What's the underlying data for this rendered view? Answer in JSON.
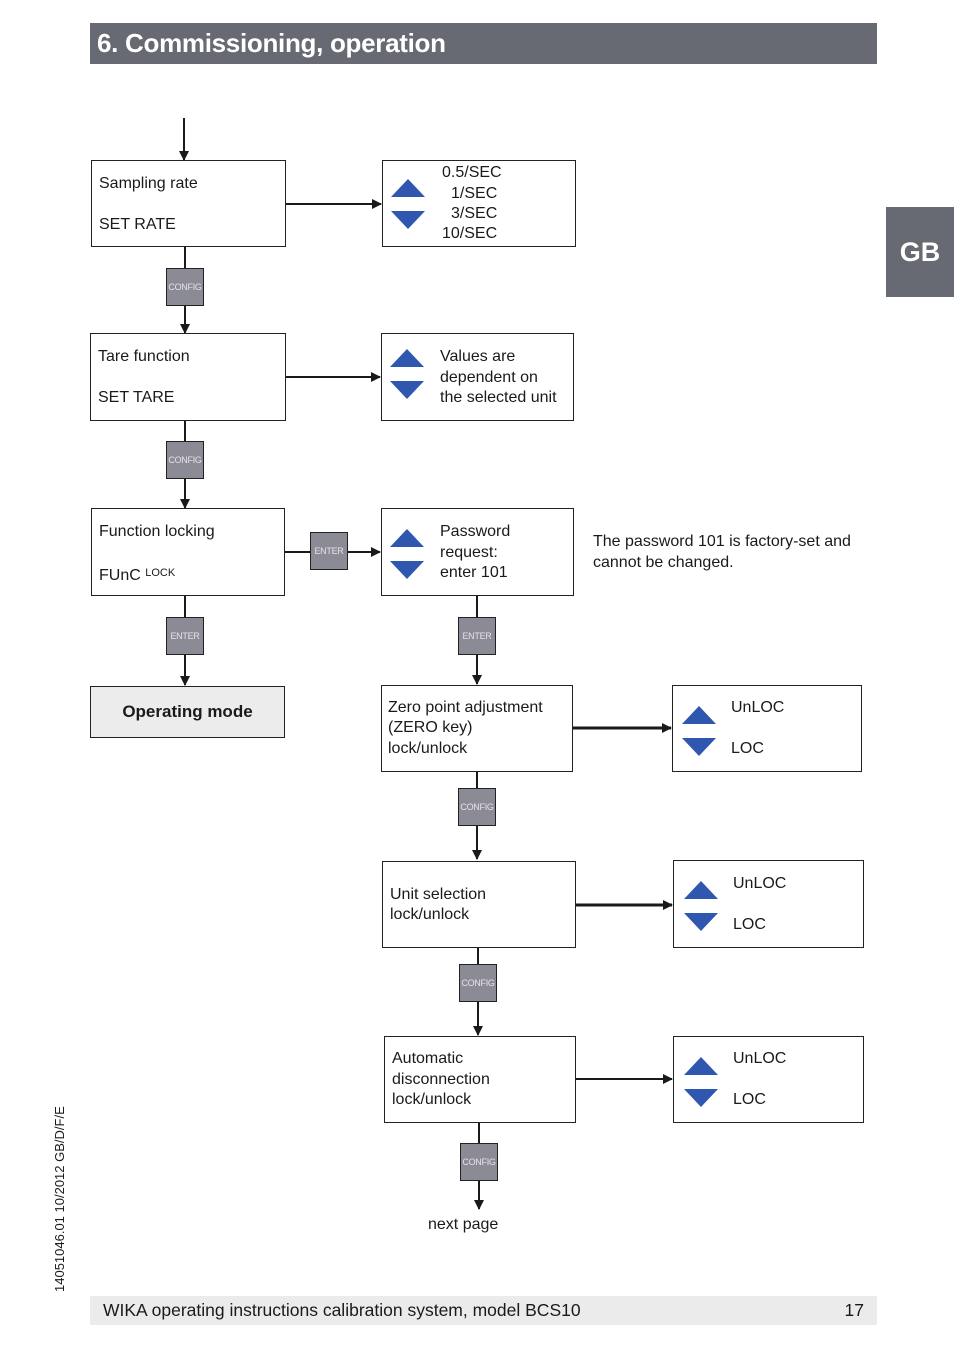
{
  "header": {
    "title": "6. Commissioning, operation"
  },
  "language_tab": "GB",
  "colors": {
    "header_bg": "#676a72",
    "arrow_blue": "#2f57b0",
    "key_bg": "#8a8b94",
    "operating_mode_bg": "#ececec",
    "footer_bg": "#ebebeb"
  },
  "keys": {
    "config": "CONFIG",
    "enter": "ENTER"
  },
  "nodes": {
    "sampling_rate": {
      "line1": "Sampling rate",
      "line2": "SET RATE"
    },
    "sampling_options": {
      "options": [
        "0.5/SEC",
        "1/SEC",
        "3/SEC",
        "10/SEC"
      ]
    },
    "tare": {
      "line1": "Tare function",
      "line2": "SET TARE"
    },
    "tare_values": {
      "lines": [
        "Values are",
        "dependent on",
        "the selected unit"
      ]
    },
    "func_lock": {
      "line1": "Function locking",
      "line2_main": "FUnC",
      "line2_sup": "LOCK"
    },
    "password": {
      "lines": [
        "Password",
        "request:",
        "enter 101"
      ]
    },
    "password_note": {
      "lines": [
        "The password 101 is factory-set and",
        "cannot be changed."
      ]
    },
    "operating_mode": {
      "label": "Operating mode"
    },
    "zero_point": {
      "lines": [
        "Zero point adjustment",
        "(ZERO key)",
        "lock/unlock"
      ]
    },
    "zero_point_options": {
      "up": "UnLOC",
      "down": "LOC"
    },
    "unit_selection": {
      "lines": [
        "Unit selection",
        "lock/unlock"
      ]
    },
    "unit_selection_options": {
      "up": "UnLOC",
      "down": "LOC"
    },
    "auto_disconnect": {
      "lines": [
        "Automatic",
        "disconnection",
        "lock/unlock"
      ]
    },
    "auto_disconnect_options": {
      "up": "UnLOC",
      "down": "LOC"
    },
    "next_page": {
      "label": "next page"
    }
  },
  "footer": {
    "text": "WIKA operating instructions calibration system, model BCS10",
    "page": "17"
  },
  "doc_ref": "14051046.01 10/2012 GB/D/F/E"
}
